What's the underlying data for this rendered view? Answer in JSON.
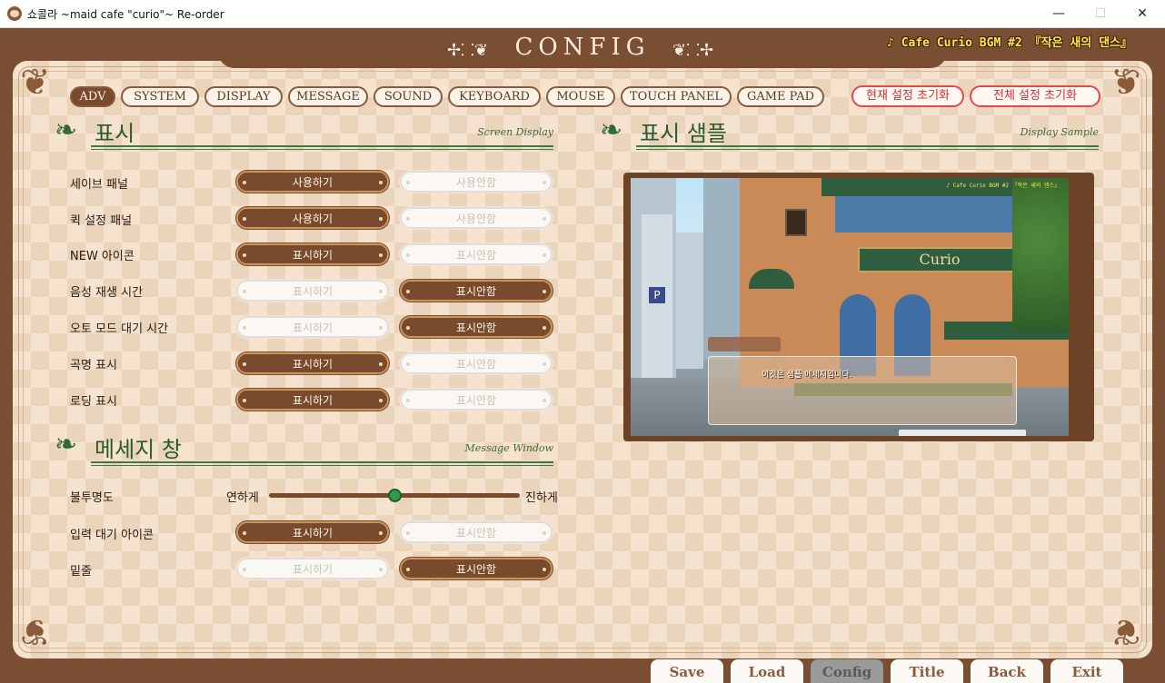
{
  "window": {
    "title": "쇼콜라 ~maid cafe \"curio\"~ Re-order",
    "minimize": "—",
    "maximize": "☐",
    "close": "✕"
  },
  "header": {
    "title": "CONFIG",
    "flourish_left": "✢⸬❦",
    "flourish_right": "❦⸬✢",
    "bgm": "♪ Cafe Curio BGM #2 『작은 새의 댄스』"
  },
  "tabs": [
    {
      "label": "ADV",
      "active": true
    },
    {
      "label": "SYSTEM",
      "active": false
    },
    {
      "label": "DISPLAY",
      "active": false
    },
    {
      "label": "MESSAGE",
      "active": false
    },
    {
      "label": "SOUND",
      "active": false
    },
    {
      "label": "KEYBOARD",
      "active": false
    },
    {
      "label": "MOUSE",
      "active": false
    },
    {
      "label": "TOUCH PANEL",
      "active": false
    },
    {
      "label": "GAME PAD",
      "active": false
    }
  ],
  "reset": {
    "current": "현재 설정 초기화",
    "all": "전체 설정 초기화"
  },
  "display_section": {
    "title": "표시",
    "subtitle": "Screen Display",
    "rows": [
      {
        "label": "세이브 패널",
        "on_label": "사용하기",
        "off_label": "사용안함",
        "selected": "on"
      },
      {
        "label": "퀵 설정 패널",
        "on_label": "사용하기",
        "off_label": "사용안함",
        "selected": "on"
      },
      {
        "label": "NEW 아이콘",
        "on_label": "표시하기",
        "off_label": "표시안함",
        "selected": "on"
      },
      {
        "label": "음성 재생 시간",
        "on_label": "표시하기",
        "off_label": "표시안함",
        "selected": "off"
      },
      {
        "label": "오토 모드 대기 시간",
        "on_label": "표시하기",
        "off_label": "표시안함",
        "selected": "off"
      },
      {
        "label": "곡명 표시",
        "on_label": "표시하기",
        "off_label": "표시안함",
        "selected": "on"
      },
      {
        "label": "로딩 표시",
        "on_label": "표시하기",
        "off_label": "표시안함",
        "selected": "on"
      }
    ]
  },
  "message_section": {
    "title": "메세지 창",
    "subtitle": "Message Window",
    "opacity": {
      "label": "불투명도",
      "left": "연하게",
      "right": "진하게",
      "value": 0.5
    },
    "rows": [
      {
        "label": "입력 대기 아이콘",
        "on_label": "표시하기",
        "off_label": "표시안함",
        "selected": "on"
      },
      {
        "label": "밑줄",
        "on_label": "표시하기",
        "off_label": "표시안함",
        "selected": "off"
      }
    ]
  },
  "sample_section": {
    "title": "표시 샘플",
    "subtitle": "Display Sample",
    "message": "이것은 샘플 메세지입니다.",
    "sign": "Curio",
    "bgm": "♪ Cafe Curio BGM #2 『작은 새의 댄스』"
  },
  "bottom_buttons": [
    {
      "label": "Save",
      "active": false
    },
    {
      "label": "Load",
      "active": false
    },
    {
      "label": "Config",
      "active": true
    },
    {
      "label": "Title",
      "active": false
    },
    {
      "label": "Back",
      "active": false
    },
    {
      "label": "Exit",
      "active": false
    }
  ],
  "colors": {
    "frame_brown": "#7a4e32",
    "accent_green": "#2f6a3a",
    "bgm_yellow": "#ffe94a",
    "reset_red": "#e24a4a"
  }
}
